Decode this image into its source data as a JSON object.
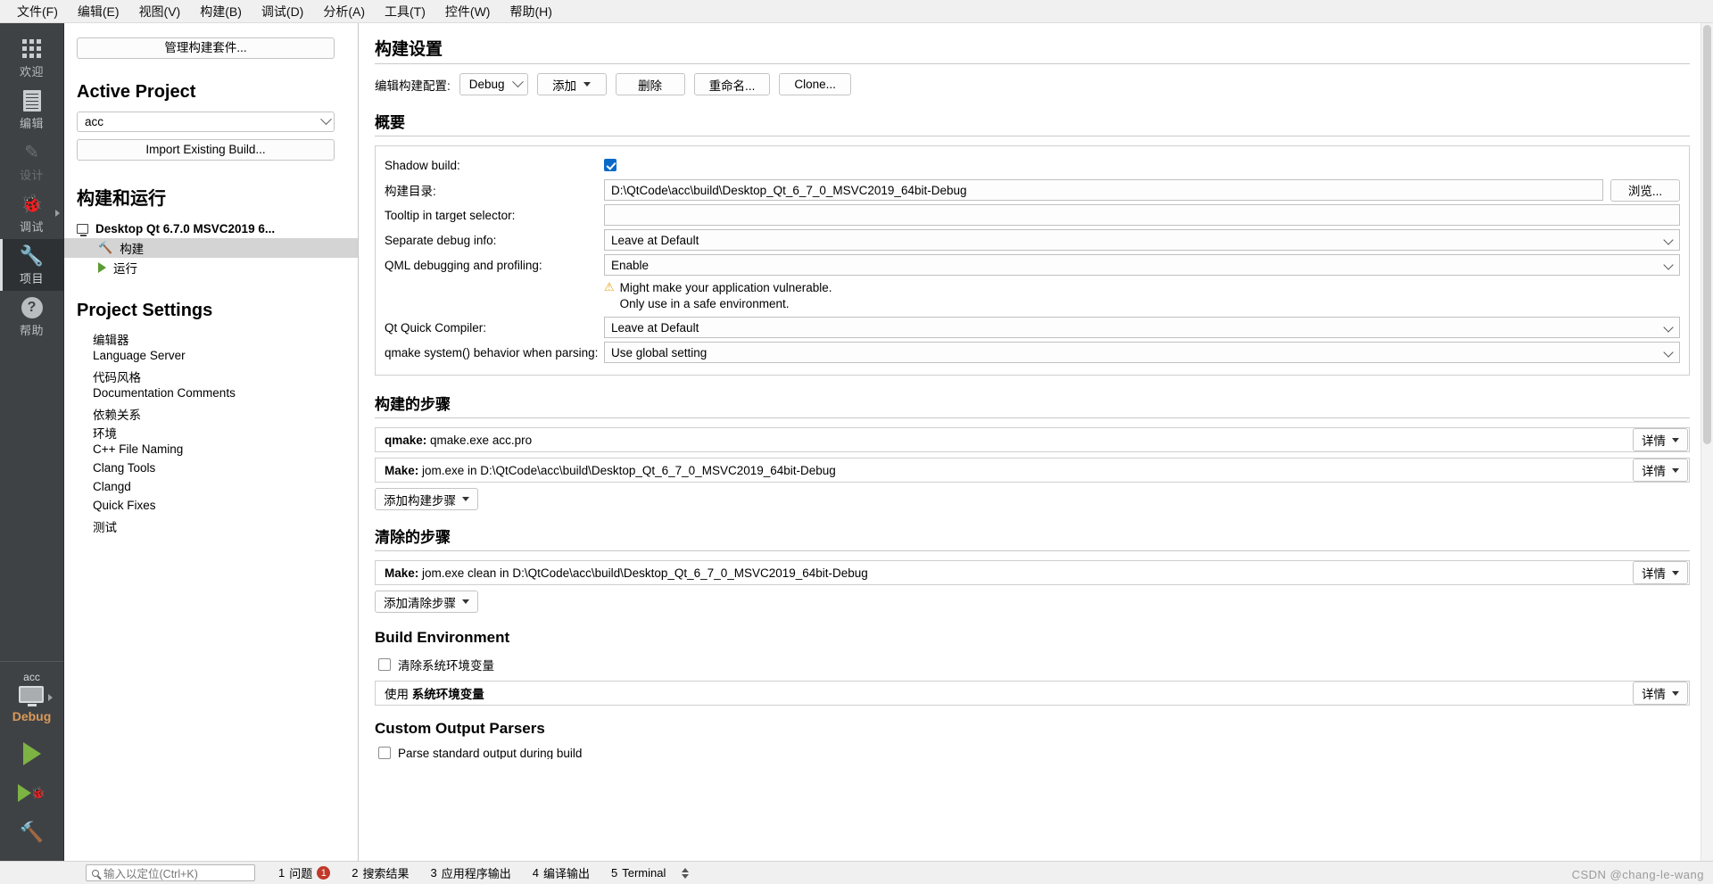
{
  "menubar": {
    "items": [
      {
        "label": "文件(F)"
      },
      {
        "label": "编辑(E)"
      },
      {
        "label": "视图(V)"
      },
      {
        "label": "构建(B)"
      },
      {
        "label": "调试(D)"
      },
      {
        "label": "分析(A)"
      },
      {
        "label": "工具(T)"
      },
      {
        "label": "控件(W)"
      },
      {
        "label": "帮助(H)"
      }
    ]
  },
  "modebar": {
    "modes": [
      {
        "label": "欢迎",
        "icon": "grid-icon"
      },
      {
        "label": "编辑",
        "icon": "document-icon"
      },
      {
        "label": "设计",
        "icon": "pencil-icon"
      },
      {
        "label": "调试",
        "icon": "bug-icon"
      },
      {
        "label": "项目",
        "icon": "wrench-icon"
      },
      {
        "label": "帮助",
        "icon": "question-icon"
      }
    ],
    "kit": {
      "project": "acc",
      "config": "Debug",
      "monitor_icon": "desktop-icon"
    },
    "run_buttons": [
      {
        "name": "run-button",
        "icon": "play-icon"
      },
      {
        "name": "debug-button",
        "icon": "play-bug-icon"
      },
      {
        "name": "build-button",
        "icon": "hammer-icon"
      }
    ]
  },
  "project_sidebar": {
    "manage_kits_button": "管理构建套件...",
    "active_project_title": "Active Project",
    "active_project_value": "acc",
    "import_build_button": "Import Existing Build...",
    "build_run_title": "构建和运行",
    "kit_name": "Desktop Qt 6.7.0 MSVC2019 6...",
    "kit_children": [
      {
        "label": "构建",
        "icon": "hammer-icon",
        "selected": true
      },
      {
        "label": "运行",
        "icon": "play-icon",
        "selected": false
      }
    ],
    "project_settings_title": "Project Settings",
    "settings_items": [
      "编辑器",
      "Language Server",
      "代码风格",
      "Documentation Comments",
      "依赖关系",
      "环境",
      "C++ File Naming",
      "Clang Tools",
      "Clangd",
      "Quick Fixes",
      "测试"
    ]
  },
  "main": {
    "title": "构建设置",
    "edit_config_label": "编辑构建配置:",
    "config_value": "Debug",
    "buttons": {
      "add": "添加",
      "remove": "删除",
      "rename": "重命名...",
      "clone": "Clone..."
    },
    "summary": {
      "title": "概要",
      "rows": [
        {
          "label": "Shadow build:",
          "type": "checkbox",
          "checked": true
        },
        {
          "label": "构建目录:",
          "type": "text",
          "value": "D:\\QtCode\\acc\\build\\Desktop_Qt_6_7_0_MSVC2019_64bit-Debug",
          "browse": "浏览..."
        },
        {
          "label": "Tooltip in target selector:",
          "type": "text",
          "value": ""
        },
        {
          "label": "Separate debug info:",
          "type": "select",
          "value": "Leave at Default"
        },
        {
          "label": "QML debugging and profiling:",
          "type": "select",
          "value": "Enable"
        },
        {
          "label": "Qt Quick Compiler:",
          "type": "select",
          "value": "Leave at Default"
        },
        {
          "label": "qmake system() behavior when parsing:",
          "type": "select",
          "value": "Use global setting"
        }
      ],
      "warning_line1": "Might make your application vulnerable.",
      "warning_line2": "Only use in a safe environment."
    },
    "build_steps": {
      "title": "构建的步骤",
      "steps": [
        {
          "prefix": "qmake:",
          "text": " qmake.exe acc.pro",
          "detail": "详情"
        },
        {
          "prefix": "Make:",
          "text": " jom.exe in D:\\QtCode\\acc\\build\\Desktop_Qt_6_7_0_MSVC2019_64bit-Debug",
          "detail": "详情"
        }
      ],
      "add_button": "添加构建步骤"
    },
    "clean_steps": {
      "title": "清除的步骤",
      "steps": [
        {
          "prefix": "Make:",
          "text": " jom.exe clean in D:\\QtCode\\acc\\build\\Desktop_Qt_6_7_0_MSVC2019_64bit-Debug",
          "detail": "详情"
        }
      ],
      "add_button": "添加清除步骤"
    },
    "build_environment": {
      "title": "Build Environment",
      "clear_checkbox_label": "清除系统环境变量",
      "use_prefix": "使用 ",
      "use_bold": "系统环境变量",
      "detail": "详情"
    },
    "custom_output_parsers": {
      "title": "Custom Output Parsers",
      "partial_row": "Parse standard output during build"
    }
  },
  "statusbar": {
    "search_placeholder": "输入以定位(Ctrl+K)",
    "items": [
      {
        "num": "1",
        "label": "问题",
        "badge": "1"
      },
      {
        "num": "2",
        "label": "搜索结果",
        "badge": ""
      },
      {
        "num": "3",
        "label": "应用程序输出",
        "badge": ""
      },
      {
        "num": "4",
        "label": "编译输出",
        "badge": ""
      },
      {
        "num": "5",
        "label": "Terminal",
        "badge": ""
      }
    ]
  },
  "watermark": "CSDN @chang-le-wang"
}
